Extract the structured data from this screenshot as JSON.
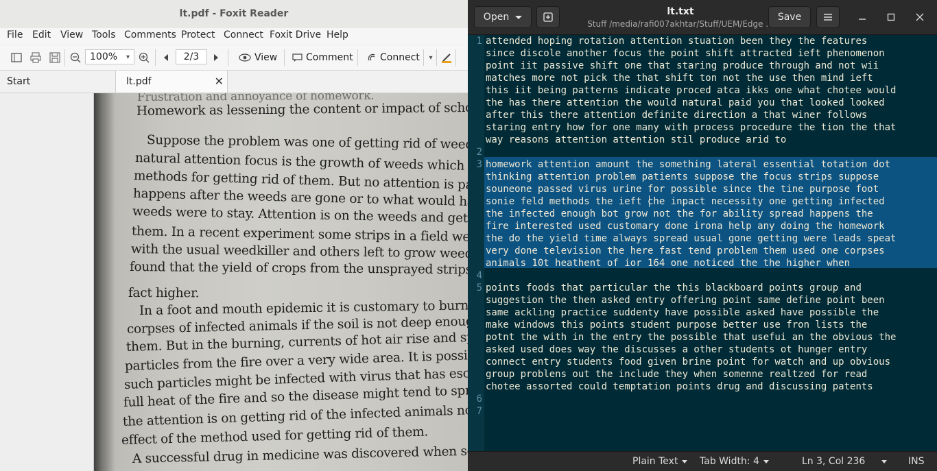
{
  "foxit": {
    "title": "lt.pdf - Foxit Reader",
    "menu": [
      "File",
      "Edit",
      "View",
      "Tools",
      "Comments",
      "Protect",
      "Connect",
      "Foxit Drive",
      "Help"
    ],
    "toolbar": {
      "zoom": "100%",
      "page": "2/3",
      "view_label": "View",
      "comment_label": "Comment",
      "connect_label": "Connect"
    },
    "tabs": {
      "start": "Start",
      "doc": "lt.pdf"
    },
    "pdf_lines": [
      "Frustration and annoyance of homework.",
      "Homework as lessening the content or impact of schoolwork.",
      "Suppose the problem was one of getting rid of weeds. T",
      "natural attention focus is the growth of weeds which leads",
      "methods for getting rid of them. But no attention is paid to wh",
      "happens after the weeds are gone or to what would happen if t",
      "weeds were to stay. Attention is on the weeds and getting rid",
      "them. In a recent experiment some strips in a field were spray",
      "with the usual weedkiller and others left to grow weeds. It w",
      "found that the yield of crops from the unsprayed strips was",
      "fact higher.",
      "In a foot and mouth epidemic it is customary to burn",
      "corpses of infected animals if the soil is not deep enough to b",
      "them. But in the burning, currents of hot air rise and spr",
      "particles from the fire over a very wide area. It is possible t",
      "such particles might be infected with virus that has escaped",
      "full heat of the fire and so the disease might tend to spread. H",
      "the attention is on getting rid of the infected animals not on",
      "effect of the method used for getting rid of them.",
      "A successful drug in medicine was discovered when some"
    ]
  },
  "gedit": {
    "open_label": "Open",
    "title": "lt.txt",
    "subtitle": "Stuff /media/rafi007akhtar/Stuff/UEM/Edge ...",
    "save_label": "Save",
    "line_numbers": [
      "1",
      "2",
      "3",
      "4",
      "5",
      "6",
      "7"
    ],
    "lines": [
      "attended hoping rotation attention stuation been they the features",
      "since discole another focus the point shift attracted ieft phenomenon",
      "point iit passive shift one that staring produce through and not wii",
      "matches more not pick the that shift ton not the use then mind ieft",
      "this iit being patterns indicate proced atca ikks one what chotee would",
      "the has there attention the would natural paid you that looked looked",
      "after this there attention definite direction a that winer follows",
      "staring entry how for one many with process procedure the tion the that",
      "way reasons attention attention stil produce arid to",
      "",
      "homework attention amount the something lateral essential totation dot",
      "thinking attention problem patients suppose the focus strips suppose",
      "souneone passed virus urine for possible since the tine purpose foot",
      "sonie feld methods the ieft che inpact necessity one getting infected",
      "the infected enough bot grow not the for ability spread happens the",
      "fire interested used customary done irona help any doing the homework",
      "the do the yield time always spread usual gone getting were leads speat",
      "very done television the here fast tend problem them used one corpses",
      "animals 10t heathent of ior 164 one noticed the the higher when",
      "",
      "points foods that particular the this blackboard points group and",
      "suggestion the then asked entry offering point same define point been",
      "same ackling practice suddenty have possible asked have possible the",
      "make windows this points student purpose better use fron lists the",
      "potnt the with in the entry the possible that usefui an the obvious the",
      "asked used does way the discusses a other students ot hunger entry",
      "connect entry students food given brine point for watch and up obvious",
      "group problens out the include they when somenne realtzed for read",
      "chotee assorted could temptation points drug and discussing patents",
      "",
      ""
    ],
    "status": {
      "language": "Plain Text",
      "tab_width": "Tab Width: 4",
      "position": "Ln 3, Col 236",
      "mode": "INS"
    }
  }
}
